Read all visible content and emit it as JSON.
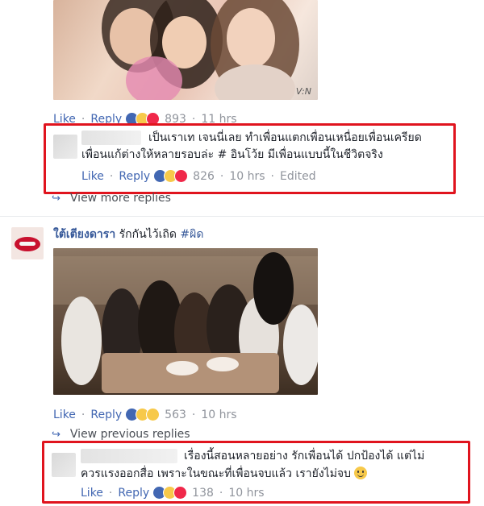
{
  "top_actions": {
    "like": "Like",
    "reply": "Reply",
    "count": "893",
    "time": "11 hrs"
  },
  "comment1": {
    "line1": "เป็นเราเท เจนนี่เลย ทำเพื่อนแตกเพื่อนเหนื่อยเพื่อนเครียด",
    "line2": "เพื่อนแก้ต่างให้หลายรอบล่ะ # อินโว้ย มีเพื่อนแบบนี้ในชีวิตจริง",
    "like": "Like",
    "reply": "Reply",
    "count": "826",
    "time": "10 hrs",
    "edited": "Edited"
  },
  "view_more": "View more replies",
  "post2": {
    "user": "ใต้เตียงดารา",
    "text": "รักกันไว้เถิด",
    "hashtag": "#ผิด",
    "like": "Like",
    "reply": "Reply",
    "count": "563",
    "time": "10 hrs"
  },
  "view_previous": "View previous replies",
  "comment2": {
    "line1": "เรื่องนี้สอนหลายอย่าง รักเพื่อนได้ ปกป้องได้ แต่ไม่",
    "line2": "ควรแรงออกสื่อ เพราะในขณะที่เพื่อนจบแล้ว เรายังไม่จบ",
    "like": "Like",
    "reply": "Reply",
    "count": "138",
    "time": "10 hrs"
  },
  "photo1_watermark": "V:N",
  "colors": {
    "link": "#4267b2",
    "name": "#365899",
    "highlight": "#e0141e",
    "meta": "#90949c"
  }
}
